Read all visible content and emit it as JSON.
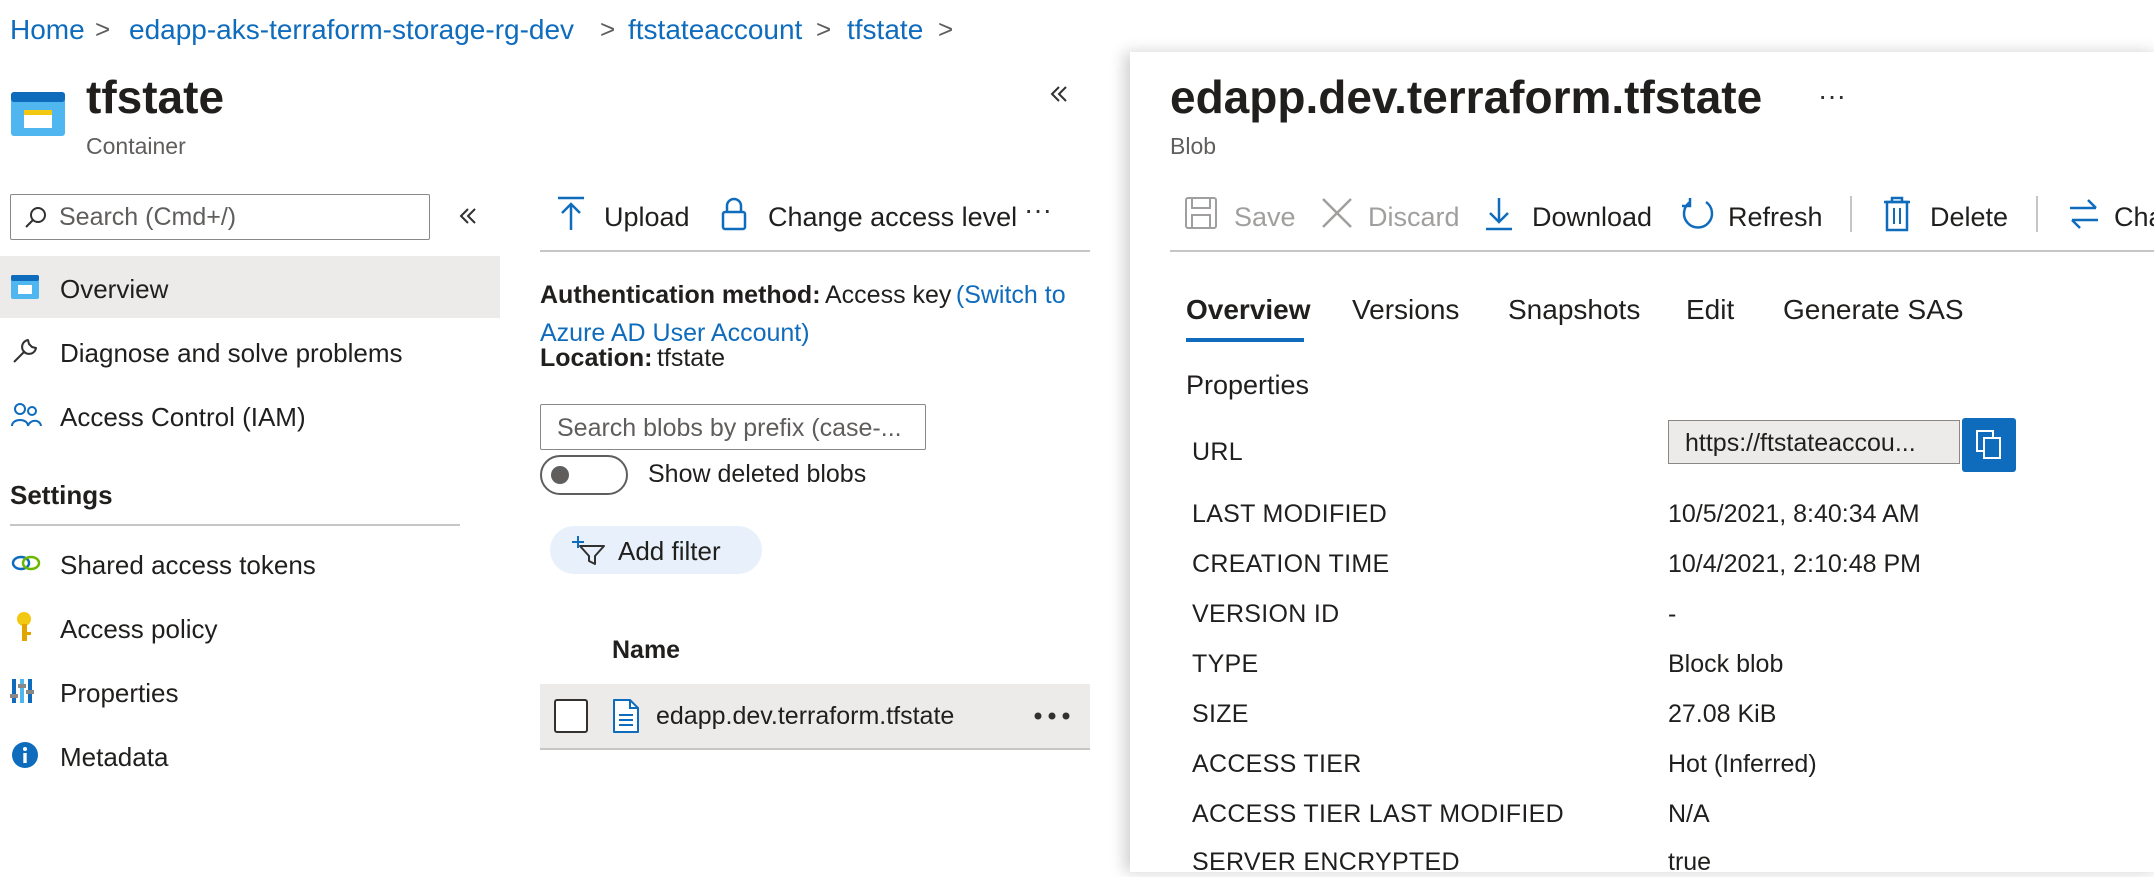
{
  "breadcrumb": {
    "items": [
      "Home",
      "edapp-aks-terraform-storage-rg-dev",
      "ftstateaccount",
      "tfstate"
    ],
    "separator": ">"
  },
  "container": {
    "title": "tfstate",
    "subtitle": "Container",
    "search_placeholder": "Search (Cmd+/)",
    "nav": [
      {
        "label": "Overview",
        "icon": "container-icon",
        "selected": true
      },
      {
        "label": "Diagnose and solve problems",
        "icon": "wrench-icon"
      },
      {
        "label": "Access Control (IAM)",
        "icon": "people-icon"
      }
    ],
    "settings_header": "Settings",
    "settings": [
      {
        "label": "Shared access tokens",
        "icon": "link-icon"
      },
      {
        "label": "Access policy",
        "icon": "key-icon"
      },
      {
        "label": "Properties",
        "icon": "properties-icon"
      },
      {
        "label": "Metadata",
        "icon": "info-icon"
      }
    ]
  },
  "blobs": {
    "toolbar": {
      "upload": "Upload",
      "change_access": "Change access level",
      "more": "···"
    },
    "auth_label": "Authentication method:",
    "auth_value": "Access key",
    "auth_switch_line1": "(Switch to",
    "auth_switch_line2": "Azure AD User Account)",
    "location_label": "Location:",
    "location_value": "tfstate",
    "search_placeholder": "Search blobs by prefix (case-...",
    "show_deleted": "Show deleted blobs",
    "add_filter": "Add filter",
    "col_name": "Name",
    "rows": [
      {
        "name": "edapp.dev.terraform.tfstate"
      }
    ]
  },
  "blob": {
    "title": "edapp.dev.terraform.tfstate",
    "subtitle": "Blob",
    "more": "···",
    "toolbar": {
      "save": "Save",
      "discard": "Discard",
      "download": "Download",
      "refresh": "Refresh",
      "delete": "Delete",
      "change": "Cha"
    },
    "tabs": [
      "Overview",
      "Versions",
      "Snapshots",
      "Edit",
      "Generate SAS"
    ],
    "active_tab": "Overview",
    "section": "Properties",
    "url_label": "URL",
    "url_value": "https://ftstateaccou...",
    "properties": [
      {
        "key": "LAST MODIFIED",
        "value": "10/5/2021, 8:40:34 AM"
      },
      {
        "key": "CREATION TIME",
        "value": "10/4/2021, 2:10:48 PM"
      },
      {
        "key": "VERSION ID",
        "value": "-"
      },
      {
        "key": "TYPE",
        "value": "Block blob"
      },
      {
        "key": "SIZE",
        "value": "27.08 KiB"
      },
      {
        "key": "ACCESS TIER",
        "value": "Hot (Inferred)"
      },
      {
        "key": "ACCESS TIER LAST MODIFIED",
        "value": "N/A"
      },
      {
        "key": "SERVER ENCRYPTED",
        "value": "true"
      }
    ]
  },
  "colors": {
    "accent": "#0f6cbd",
    "selected_bg": "#edebe9",
    "filter_pill": "#e8f1fb"
  }
}
